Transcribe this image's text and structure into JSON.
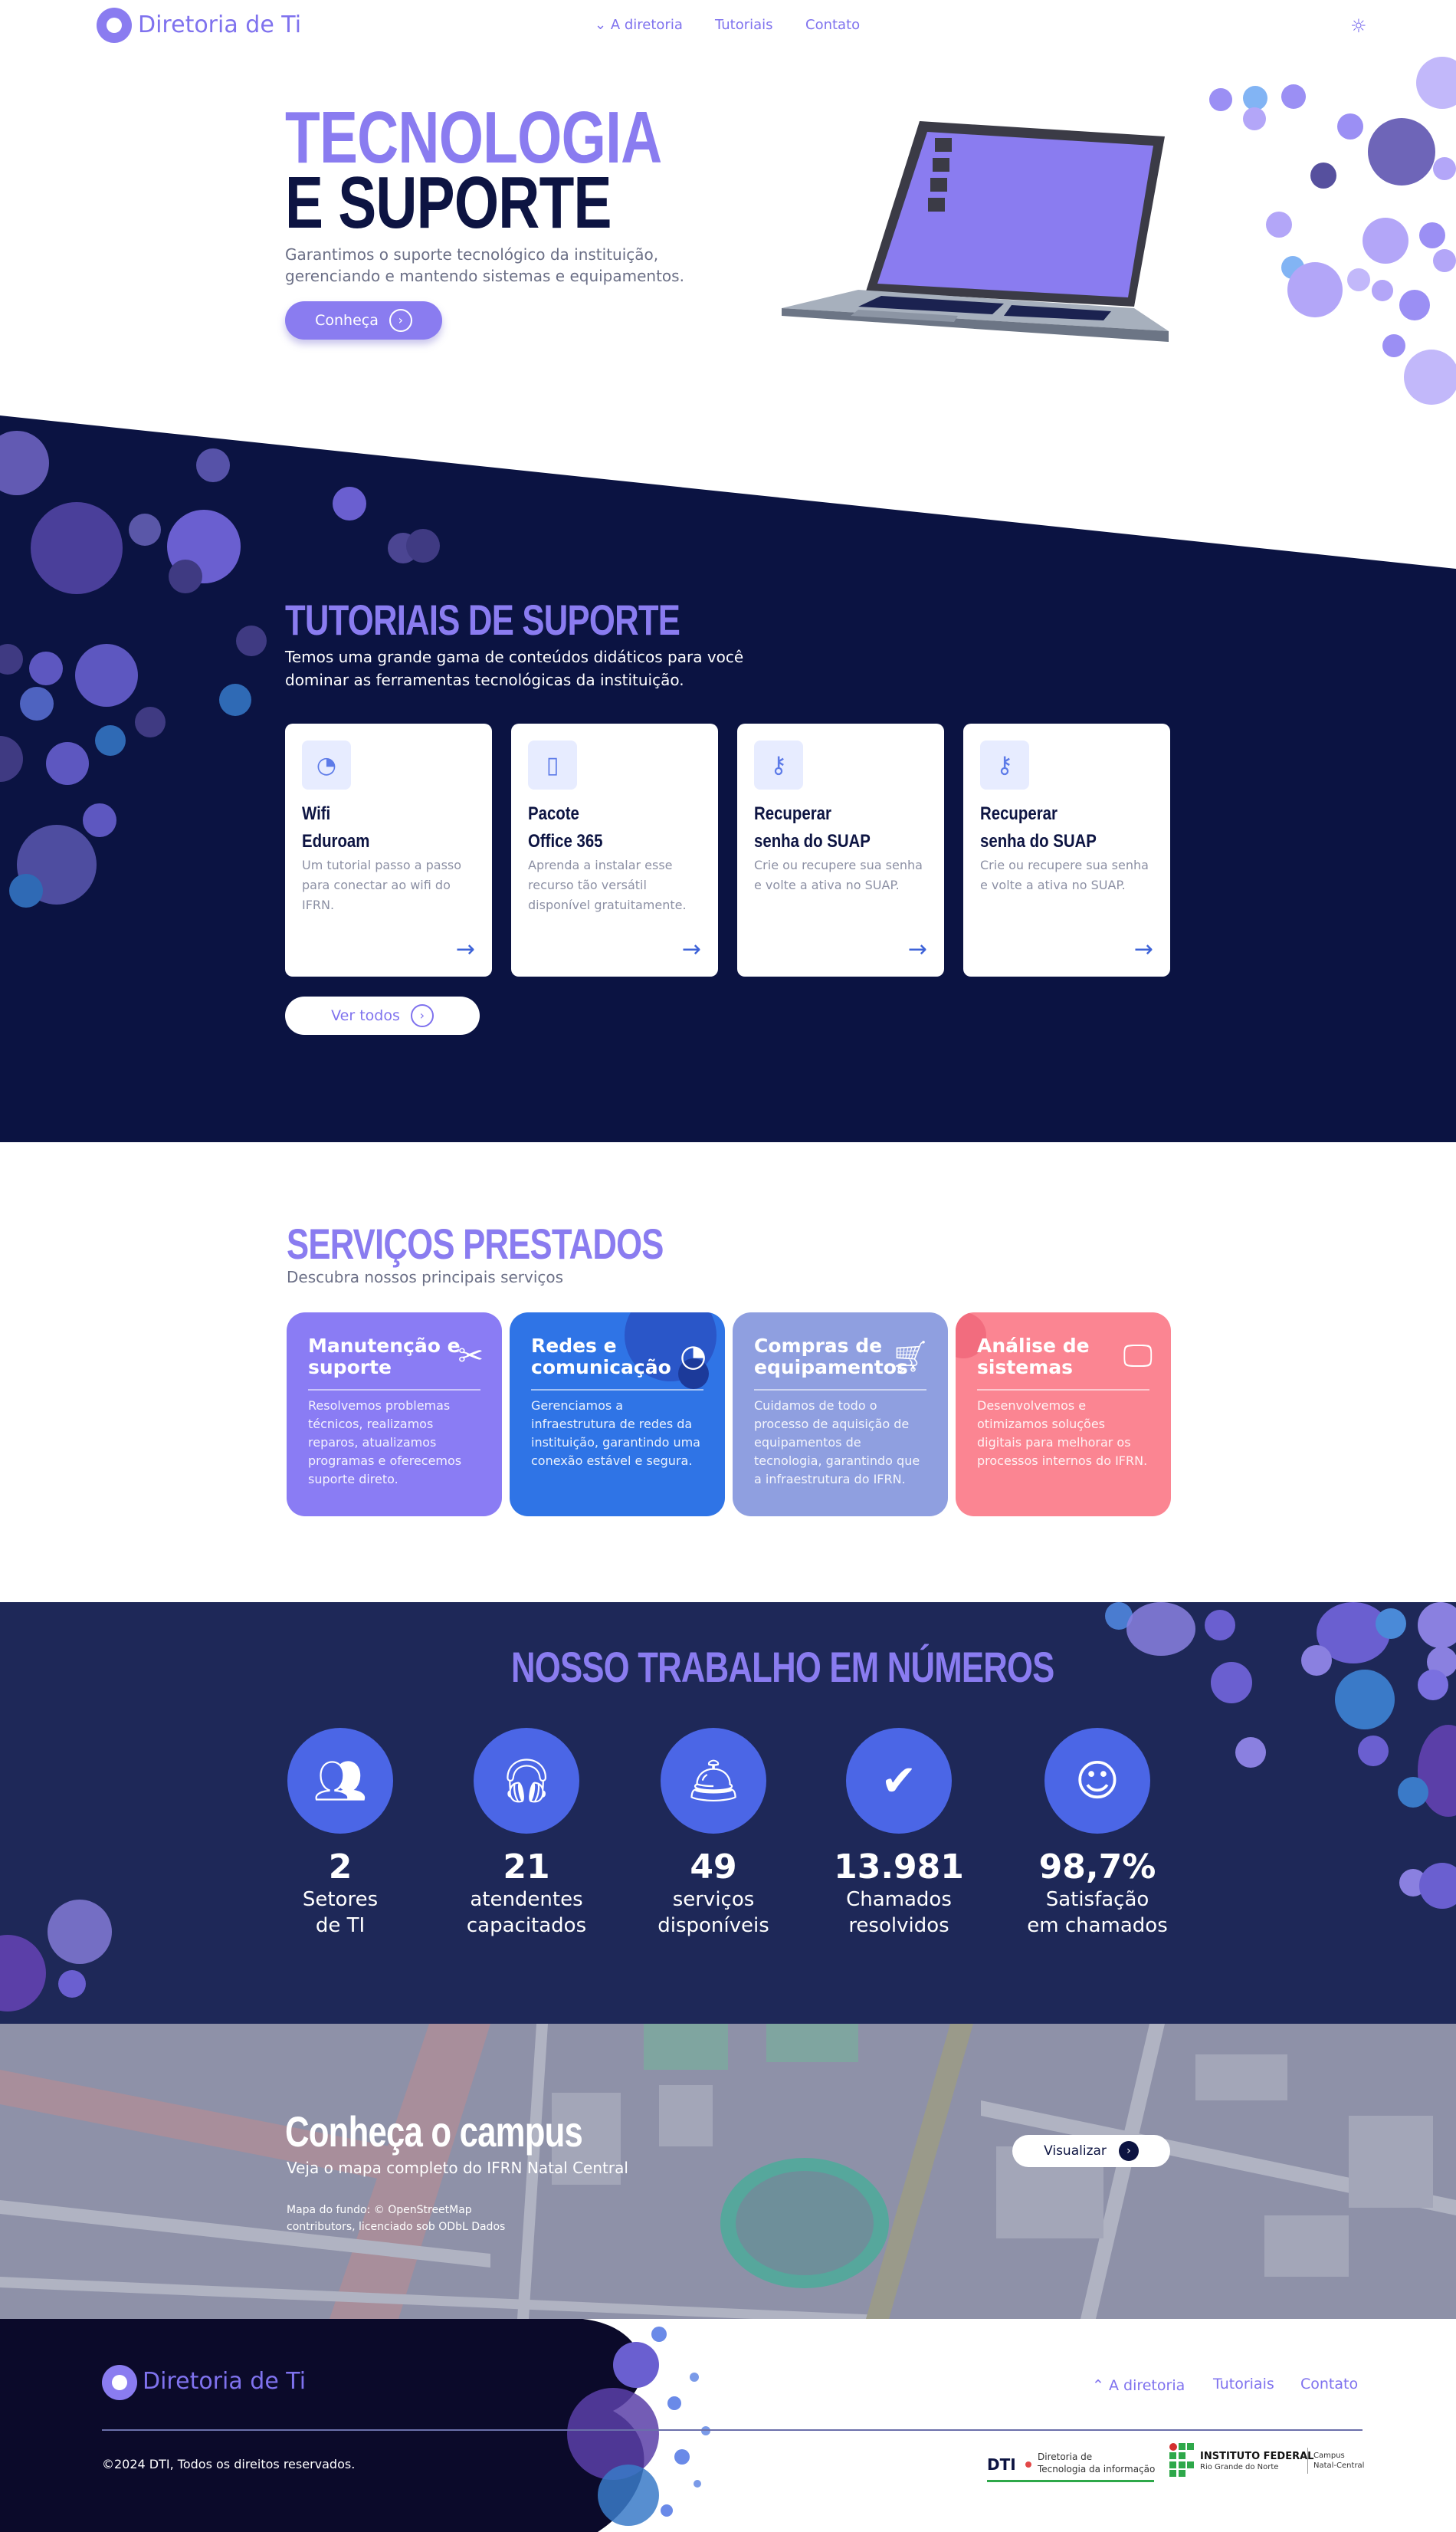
{
  "header": {
    "logo_text": "Diretoria de Ti",
    "nav": [
      {
        "label": "A diretoria",
        "icon": "chevron-down-icon"
      },
      {
        "label": "Tutoriais"
      },
      {
        "label": "Contato"
      }
    ],
    "theme_icon": "sun-icon"
  },
  "hero": {
    "title_line1": "TECNOLOGIA",
    "title_line2": "E SUPORTE",
    "description": "Garantimos o suporte tecnológico da instituição, gerenciando e mantendo sistemas e equipamentos.",
    "cta_label": "Conheça"
  },
  "tutorials": {
    "title": "TUTORIAIS DE SUPORTE",
    "description": "Temos uma grande gama de conteúdos didáticos para você dominar as ferramentas tecnológicas  da instituição.",
    "cards": [
      {
        "title_l1": "Wifi",
        "title_l2": "Eduroam",
        "desc": "Um tutorial passo a passo para conectar ao wifi do IFRN.",
        "icon": "wifi-icon"
      },
      {
        "title_l1": "Pacote",
        "title_l2": "Office 365",
        "desc": "Aprenda a instalar esse recurso tão versátil disponível gratuitamente.",
        "icon": "office-icon"
      },
      {
        "title_l1": "Recuperar",
        "title_l2": "senha do SUAP",
        "desc": "Crie ou recupere sua senha e volte a ativa no SUAP.",
        "icon": "key-icon"
      },
      {
        "title_l1": "Recuperar",
        "title_l2": "senha do SUAP",
        "desc": "Crie ou recupere sua senha e volte a ativa no SUAP.",
        "icon": "key-icon"
      }
    ],
    "view_all_label": "Ver todos"
  },
  "services": {
    "title": "SERVIÇOS PRESTADOS",
    "subtitle": "Descubra nossos principais serviços",
    "cards": [
      {
        "title": "Manutenção e suporte",
        "desc": "Resolvemos problemas técnicos, realizamos reparos, atualizamos programas e oferecemos suporte direto.",
        "icon": "tools-icon",
        "color": "#8a7cf4"
      },
      {
        "title": "Redes e comunicação",
        "desc": "Gerenciamos a infraestrutura de redes da instituição, garantindo uma conexão estável e segura.",
        "icon": "wifi-icon",
        "color": "#2f74e6"
      },
      {
        "title": "Compras de equipamentos",
        "desc": "Cuidamos de todo o processo de aquisição de equipamentos de tecnologia, garantindo que a infraestrutura do IFRN.",
        "icon": "cart-icon",
        "color": "#8f9fe0"
      },
      {
        "title": "Análise de sistemas",
        "desc": "Desenvolvemos e otimizamos soluções digitais para melhorar os processos internos do IFRN.",
        "icon": "monitor-icon",
        "color": "#fb8592"
      }
    ]
  },
  "numbers": {
    "title": "NOSSO TRABALHO EM NÚMEROS",
    "stats": [
      {
        "value": "2",
        "label_l1": "Setores",
        "label_l2": "de TI",
        "icon": "group-icon"
      },
      {
        "value": "21",
        "label_l1": "atendentes",
        "label_l2": "capacitados",
        "icon": "headset-icon"
      },
      {
        "value": "49",
        "label_l1": "serviços",
        "label_l2": "disponíveis",
        "icon": "service-bell-icon"
      },
      {
        "value": "13.981",
        "label_l1": "Chamados",
        "label_l2": "resolvidos",
        "icon": "check-icon"
      },
      {
        "value": "98,7%",
        "label_l1": "Satisfação",
        "label_l2": "em chamados",
        "icon": "smile-icon"
      }
    ]
  },
  "campus": {
    "title": "Conheça o campus",
    "subtitle": "Veja o mapa completo do IFRN Natal Central",
    "credit_l1": "Mapa do fundo: © OpenStreetMap",
    "credit_l2": "contributors, licenciado sob ODbL Dados",
    "button_label": "Visualizar"
  },
  "footer": {
    "logo_text": "Diretoria de Ti",
    "nav": [
      {
        "label": "A diretoria",
        "icon": "chevron-up-icon"
      },
      {
        "label": "Tutoriais"
      },
      {
        "label": "Contato"
      }
    ],
    "copyright": "©2024 DTI, Todos os direitos reservados.",
    "dti_logo": {
      "abbr": "DTI",
      "l1": "Diretoria de",
      "l2": "Tecnologia da informação"
    },
    "if_logo": {
      "name": "INSTITUTO FEDERAL",
      "sub": "Rio Grande do Norte",
      "campus_l1": "Campus",
      "campus_l2": "Natal-Central"
    }
  },
  "colors": {
    "primary": "#8a7cf0",
    "navy": "#0d1442",
    "numbers_bg": "#1e2858",
    "footer_bg": "#0b0a2a"
  }
}
